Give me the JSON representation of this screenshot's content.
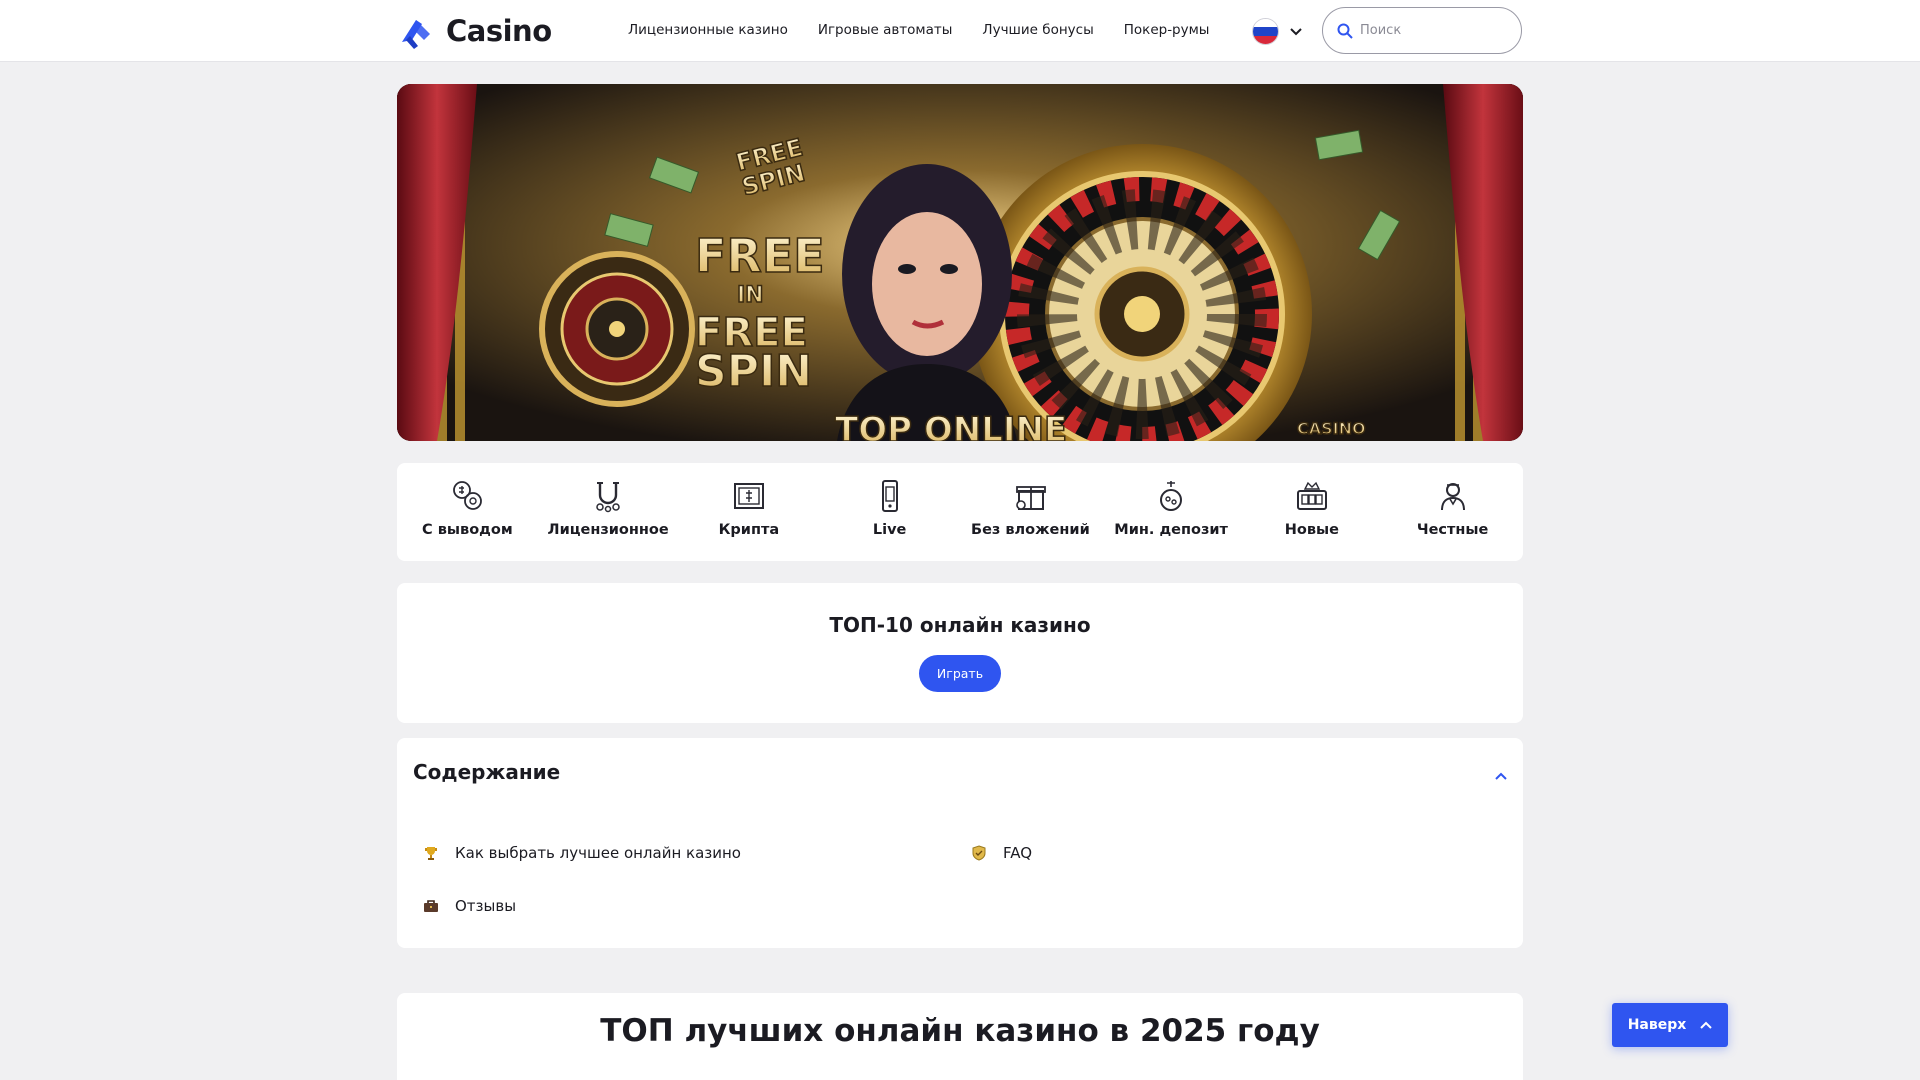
{
  "header": {
    "logo_text": "Casino",
    "nav": [
      "Лицензионные казино",
      "Игровые автоматы",
      "Лучшие бонусы",
      "Покер-румы"
    ],
    "search_placeholder": "Поиск"
  },
  "banner": {
    "text_free_spin_top": "FREE SPIN",
    "text_free_in_free_spin": [
      "FREE",
      "IN",
      "FREE",
      "SPIN"
    ],
    "text_bottom": "TOP ONLINE",
    "text_casino": "CASINO",
    "text_free_ribbon": "FREE"
  },
  "categories": [
    {
      "label": "С выводом",
      "icon": "coins-withdraw-icon"
    },
    {
      "label": "Лицензионное",
      "icon": "horseshoe-icon"
    },
    {
      "label": "Крипта",
      "icon": "crypto-wallet-icon"
    },
    {
      "label": "Live",
      "icon": "mobile-live-icon"
    },
    {
      "label": "Без вложений",
      "icon": "gift-icon"
    },
    {
      "label": "Мин. депозит",
      "icon": "min-deposit-icon"
    },
    {
      "label": "Новые",
      "icon": "new-slot-icon"
    },
    {
      "label": "Честные",
      "icon": "dealer-icon"
    }
  ],
  "top10": {
    "title": "ТОП-10 онлайн казино",
    "button": "Играть"
  },
  "toc": {
    "title": "Содержание",
    "items": [
      {
        "label": "Как выбрать лучшее онлайн казино",
        "icon": "trophy-icon"
      },
      {
        "label": "FAQ",
        "icon": "shield-icon"
      },
      {
        "label": "Отзывы",
        "icon": "briefcase-icon"
      }
    ]
  },
  "main": {
    "heading": "ТОП лучших онлайн казино в 2025 году"
  },
  "up_button": {
    "label": "Наверх"
  },
  "colors": {
    "accent": "#2f55f0",
    "page_bg": "#f0f0f2",
    "card_bg": "#ffffff",
    "text": "#1b1b22"
  }
}
